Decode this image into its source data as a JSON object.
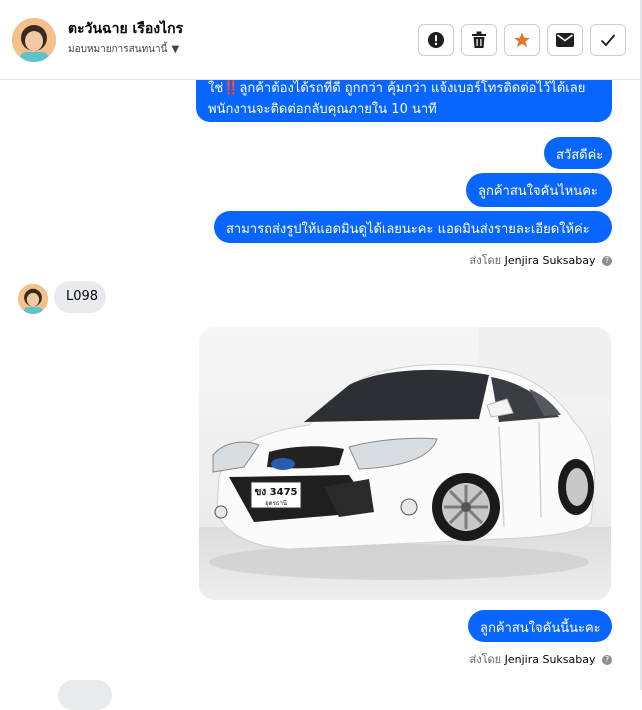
{
  "header": {
    "contact_name": "ตะวันฉาย เรืองไกร",
    "assign_label": "มอบหมายการสนทนานี้",
    "actions": [
      "spam-alert",
      "delete",
      "star",
      "mark-unread",
      "done"
    ]
  },
  "messages": {
    "top_bubble_line1": "ใช่‼️ลูกค้าต้องได้รถที่ดี ถูกกว่า คุ้มกว่า แจ้งเบอร์โทรติดต่อไว้ได้เลย",
    "top_bubble_line2": "พนักงานจะติดต่อกลับคุณภายใน 10 นาที",
    "greeting": "สวัสดีค่ะ",
    "question": "ลูกค้าสนใจคันไหนคะ",
    "request_photo": "สามารถส่งรูปให้แอดมินดูได้เลยนะคะ แอดมินส่งรายละเอียดให้ค่ะ",
    "sent_by_prefix": "ส่งโดย",
    "sender_name": "Jenjira Suksabay",
    "customer_reply": "L098",
    "car_plate_main": "ขง 3475",
    "car_plate_sub": "อุดรธานี",
    "followup": "ลูกค้าสนใจคันนี้นะคะ"
  },
  "colors": {
    "accent": "#0866ff",
    "incoming_bubble": "#e9eaed",
    "star": "#e8772e"
  }
}
